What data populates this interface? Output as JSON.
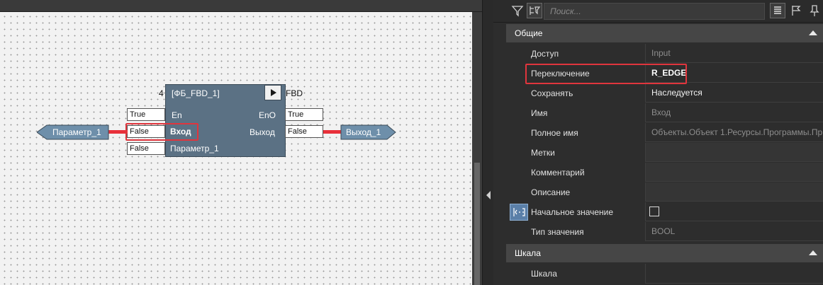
{
  "diagram": {
    "block_number": "4",
    "block_title": "[ФБ_FBD_1]",
    "block_type": "FBD",
    "pins": {
      "en": "En",
      "eno": "EnO",
      "input": "Вход",
      "output": "Выход",
      "param": "Параметр_1"
    },
    "input_values": [
      "True",
      "False",
      "False"
    ],
    "output_values": [
      "True",
      "False"
    ],
    "input_tag": "Параметр_1",
    "output_tag": "Выход_1"
  },
  "toolbar": {
    "search_placeholder": "Поиск..."
  },
  "properties": {
    "section_general": "Общие",
    "rows": [
      {
        "label": "Доступ",
        "value": "Input"
      },
      {
        "label": "Переключение",
        "value": "R_EDGE"
      },
      {
        "label": "Сохранять",
        "value": "Наследуется"
      },
      {
        "label": "Имя",
        "value": "Вход"
      },
      {
        "label": "Полное имя",
        "value": "Объекты.Объект 1.Ресурсы.Программы.Пр"
      },
      {
        "label": "Метки",
        "value": ""
      },
      {
        "label": "Комментарий",
        "value": ""
      },
      {
        "label": "Описание",
        "value": ""
      },
      {
        "label": "Начальное значение",
        "value": ""
      },
      {
        "label": "Тип значения",
        "value": "BOOL"
      }
    ],
    "section_scale": "Шкала",
    "scale_row_label": "Шкала"
  },
  "colors": {
    "block_fill": "#5b7184",
    "wire": "#e8303a",
    "highlight": "#e0353d",
    "tag_fill": "#6e8faa",
    "panel_bg": "#2d2d2d"
  },
  "icons": [
    "filter-icon",
    "tree-filter-icon",
    "list-view-icon",
    "flag-icon",
    "pin-icon",
    "initial-value-icon",
    "collapse-arrow-icon"
  ]
}
